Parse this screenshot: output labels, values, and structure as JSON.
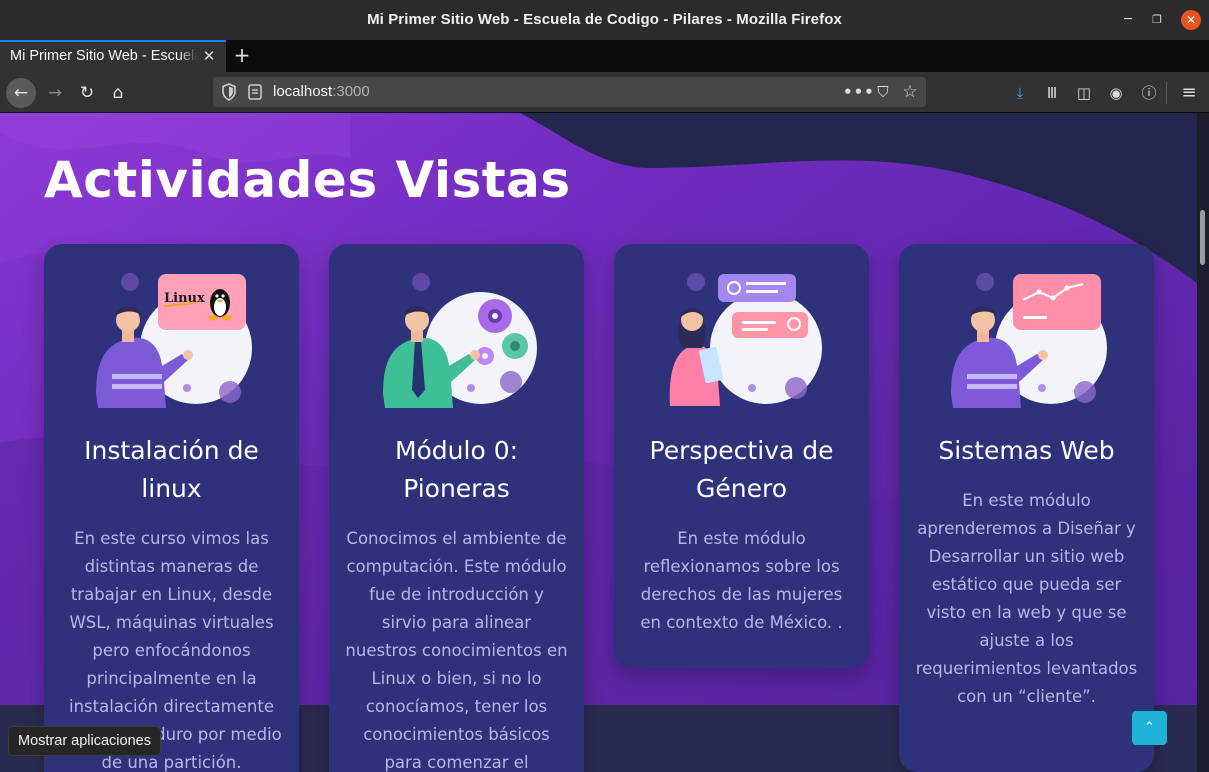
{
  "window": {
    "title": "Mi Primer Sitio Web - Escuela de Codigo - Pilares - Mozilla Firefox",
    "minimize_glyph": "─",
    "maximize_glyph": "❐",
    "close_glyph": "✕"
  },
  "tabs": [
    {
      "label": "Mi Primer Sitio Web - Escuela de Codigo - Pilares",
      "close_glyph": "✕",
      "active": true
    }
  ],
  "new_tab_glyph": "+",
  "nav": {
    "back_glyph": "←",
    "forward_glyph": "→",
    "reload_glyph": "↻",
    "home_glyph": "⌂",
    "url_host": "localhost",
    "url_port": ":3000",
    "page_actions_glyph": "•••",
    "pocket_glyph": "⛉",
    "bookmark_glyph": "☆",
    "download_glyph": "⤓",
    "library_glyph": "Ⅲ",
    "sidebar_glyph": "◫",
    "account_glyph": "◉",
    "info_glyph": "ⓘ",
    "menu_glyph": "≡"
  },
  "page": {
    "heading": "Actividades Vistas",
    "cards": [
      {
        "title_line1": "Instalación de",
        "title_line2": "linux",
        "description": "En este curso vimos las distintas maneras de trabajar en Linux, desde WSL, máquinas virtuales pero enfocándonos principalmente en la instalación directamente en el disco duro por medio de una partición.",
        "screen_label": "Linux"
      },
      {
        "title_line1": "Módulo 0:",
        "title_line2": "Pioneras",
        "description": "Conocimos el ambiente de computación. Este módulo fue de introducción y sirvio para alinear nuestros conocimientos en Linux o bien, si no lo conocíamos, tener los conocimientos básicos para comenzar el"
      },
      {
        "title_line1": "Perspectiva de",
        "title_line2": "Género",
        "description": "En este módulo reflexionamos sobre los derechos de las mujeres en contexto de México. ."
      },
      {
        "title_line1": "Sistemas Web",
        "title_line2": "",
        "description": "En este módulo aprenderemos a Diseñar y Desarrollar un sitio web estático que pueda ser visto en la web y que se ajuste a los requerimientos levantados con un “cliente”."
      }
    ],
    "back_to_top_glyph": "⌃"
  },
  "tooltip": {
    "text": "Mostrar aplicaciones"
  },
  "colors": {
    "accent_purple": "#7b2fc9",
    "card_bg": "#2e327a",
    "card_text": "#b5b7ec",
    "back_to_top": "#1eb2d6",
    "firefox_blue": "#0a84ff"
  }
}
